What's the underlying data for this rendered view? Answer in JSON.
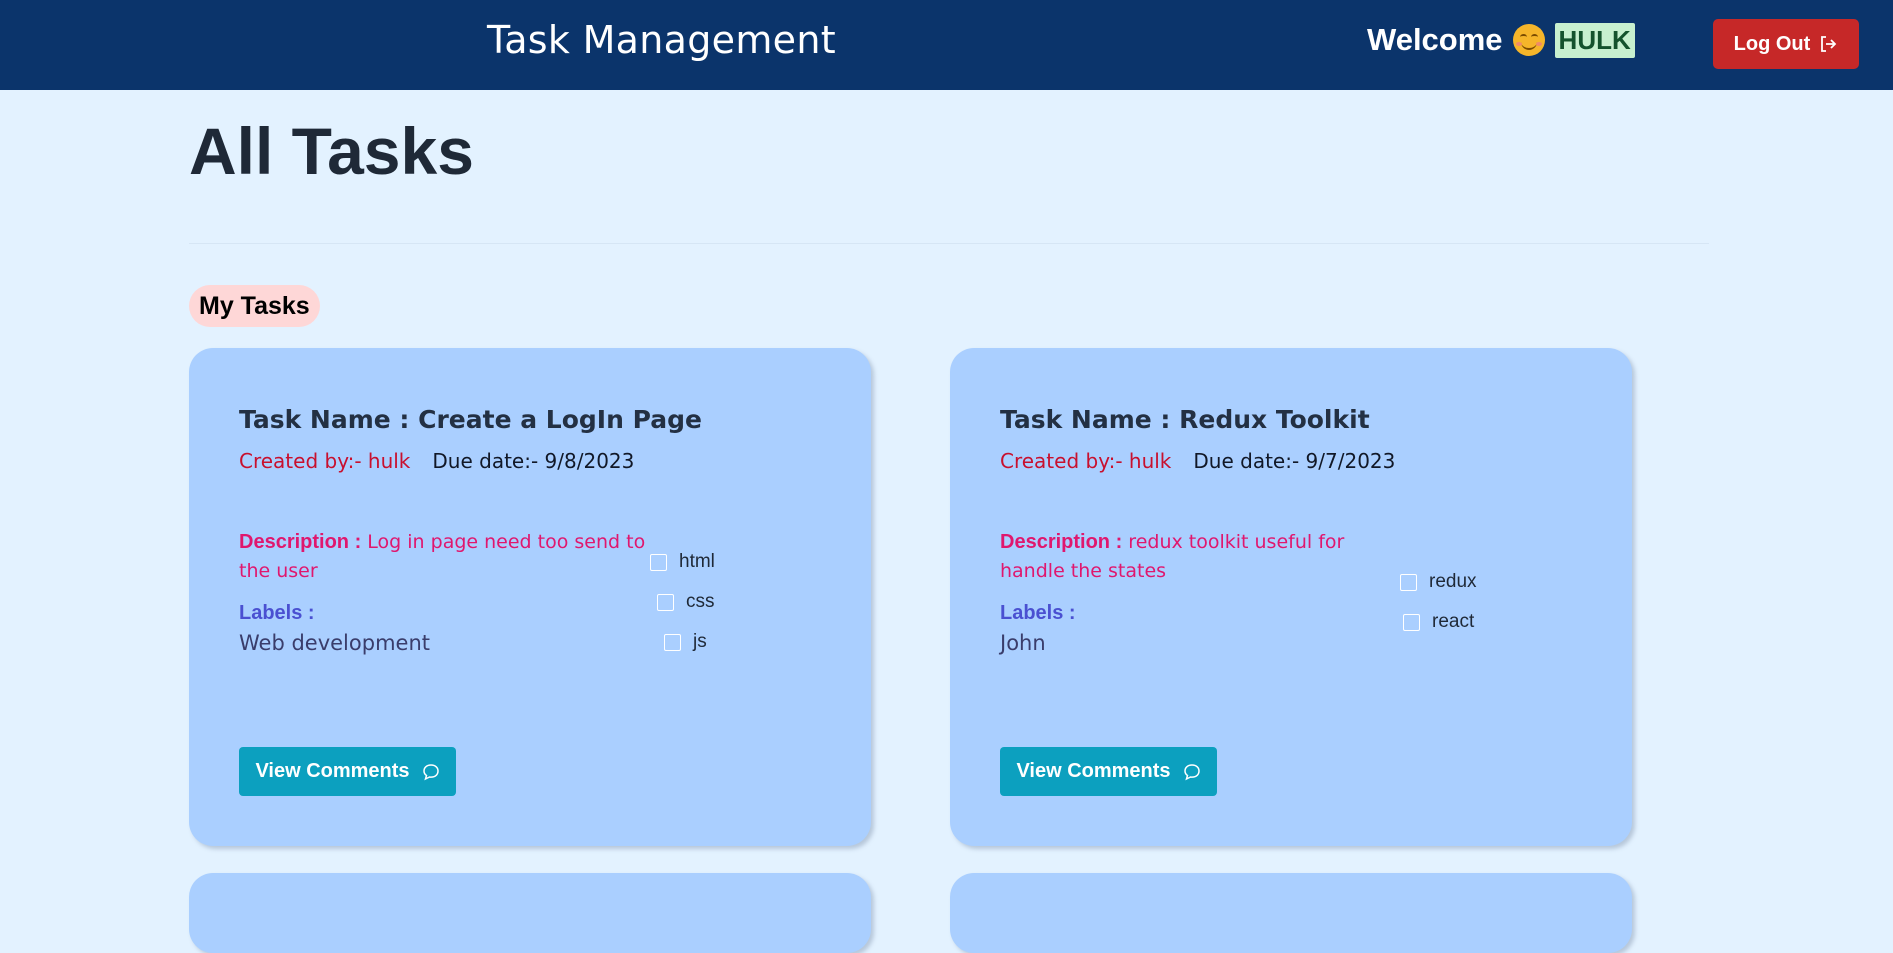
{
  "header": {
    "title": "Task Management",
    "welcome_text": "Welcome",
    "username": "HULK",
    "logout_label": "Log Out",
    "bg_color": "#0b346b"
  },
  "page": {
    "title": "All Tasks",
    "section_label": "My Tasks"
  },
  "tasks": [
    {
      "name": "Task Name : Create a LogIn Page",
      "created_by": "Created by:- hulk",
      "due_date": "Due date:- 9/8/2023",
      "description_label": "Description :",
      "description": "Log in page need too send to the user",
      "labels_heading": "Labels :",
      "labels_value": "Web development",
      "checklist": [
        "html",
        "css",
        "js"
      ],
      "comments_label": "View Comments"
    },
    {
      "name": "Task Name : Redux Toolkit",
      "created_by": "Created by:- hulk",
      "due_date": "Due date:- 9/7/2023",
      "description_label": "Description :",
      "description": "redux toolkit useful for handle the states",
      "labels_heading": "Labels :",
      "labels_value": "John",
      "checklist": [
        "redux",
        "react"
      ],
      "comments_label": "View Comments"
    }
  ],
  "colors": {
    "background": "#e3f2ff",
    "card": "#aacfff",
    "logout": "#c62828",
    "comments_button": "#0ca0bf",
    "created_by": "#c8102e",
    "description": "#e0176e",
    "labels_heading": "#4a50d1"
  },
  "icons": {
    "logout": "logout-arrow-icon",
    "comments": "chat-bubble-icon",
    "emoji": "smiling-face-icon"
  }
}
